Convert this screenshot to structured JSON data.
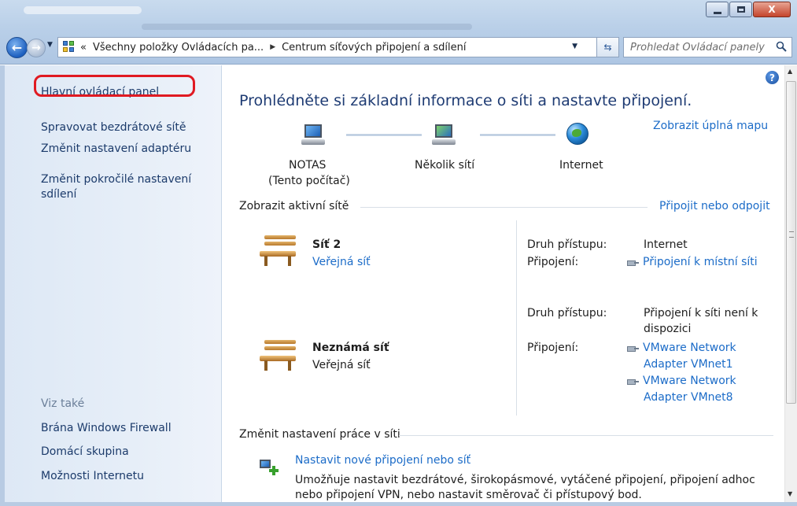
{
  "window": {
    "minimize": "",
    "maximize": "",
    "close": "X"
  },
  "address": {
    "back": "←",
    "forward": "→",
    "overflow": "«",
    "crumb1": "Všechny položky Ovládacích pa...",
    "crumb_sep": "▶",
    "crumb2": "Centrum síťových připojení a sdílení",
    "refresh": "⇆",
    "search_placeholder": "Prohledat Ovládací panely"
  },
  "sidebar": {
    "home": "Hlavní ovládací panel",
    "items": [
      "Spravovat bezdrátové sítě",
      "Změnit nastavení adaptéru",
      "Změnit pokročilé nastavení sdílení"
    ],
    "see_also": "Viz také",
    "see_also_items": [
      "Brána Windows Firewall",
      "Domácí skupina",
      "Možnosti Internetu"
    ]
  },
  "main": {
    "heading": "Prohlédněte si základní informace o síti a nastavte připojení.",
    "full_map_link": "Zobrazit úplná mapu",
    "map": {
      "node1_name": "NOTAS",
      "node1_sub": "(Tento počítač)",
      "node2_name": "Několik sítí",
      "node3_name": "Internet"
    },
    "active_networks_title": "Zobrazit aktivní sítě",
    "connect_link": "Připojit nebo odpojit",
    "networks": [
      {
        "name": "Síť 2",
        "type": "Veřejná síť",
        "access_label": "Druh přístupu:",
        "access_value": "Internet",
        "connection_label": "Připojení:",
        "connection_value": "Připojení k místní síti"
      },
      {
        "name": "Neznámá síť",
        "type": "Veřejná síť",
        "access_label": "Druh přístupu:",
        "access_value_line1": "Připojení k síti není k",
        "access_value_line2": "dispozici",
        "connection_label": "Připojení:",
        "connections": [
          {
            "line1": "VMware Network",
            "line2": "Adapter VMnet1"
          },
          {
            "line1": "VMware Network",
            "line2": "Adapter VMnet8"
          }
        ]
      }
    ],
    "change_settings_title": "Změnit nastavení práce v síti",
    "setup_link": "Nastavit nové připojení nebo síť",
    "setup_desc_line1": "Umožňuje nastavit bezdrátové, širokopásmové, vytáčené připojení, připojení adhoc",
    "setup_desc_line2": "nebo připojení VPN, nebo nastavit směrovač či přístupový bod."
  },
  "help": "?",
  "colors": {
    "link": "#1c6cc8",
    "heading": "#1e3b73",
    "highlight": "#e01a22",
    "sidebar_text": "#1c3b6b"
  },
  "icons": [
    "back-icon",
    "forward-icon",
    "control-panel-icon",
    "refresh-icon",
    "search-icon",
    "computer-icon",
    "network-icon",
    "globe-icon",
    "bench-icon",
    "adapter-icon",
    "setup-connection-icon",
    "help-icon"
  ]
}
